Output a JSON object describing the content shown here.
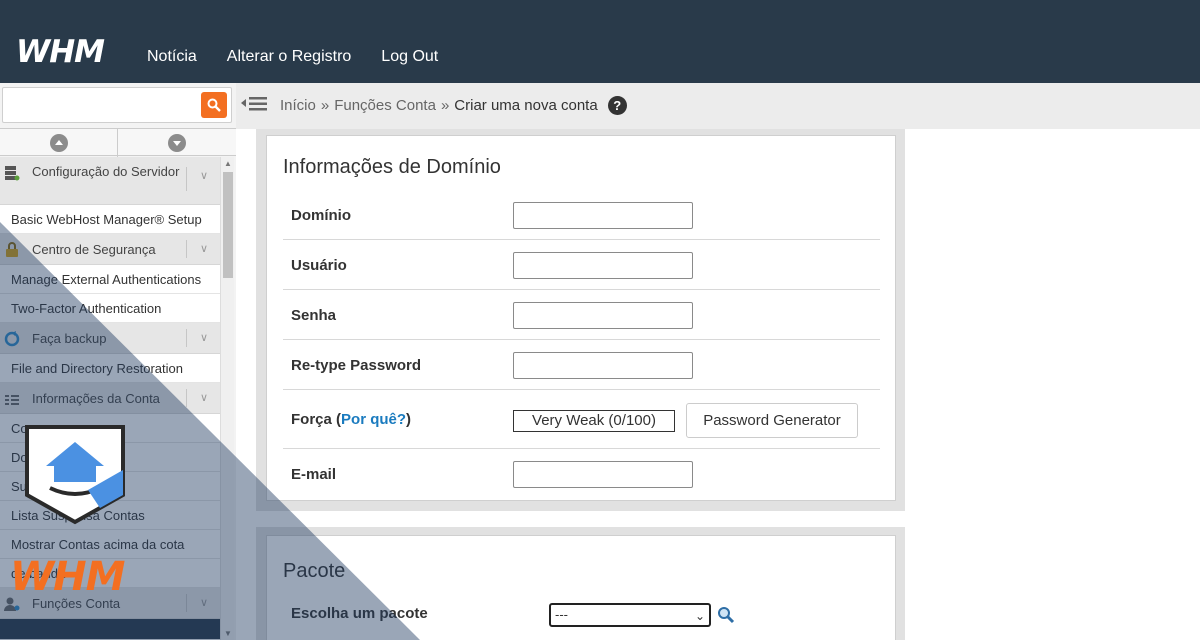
{
  "topbar": {
    "logo": "WHM",
    "nav": [
      "Notícia",
      "Alterar o Registro",
      "Log Out"
    ]
  },
  "sidebar": {
    "search": {
      "placeholder": ""
    },
    "sections": [
      {
        "icon": "server-config-icon",
        "label": "Configuração do Servidor",
        "items": [
          "Basic WebHost Manager® Setup"
        ]
      },
      {
        "icon": "lock-icon",
        "label": "Centro de Segurança",
        "items": [
          "Manage External Authentications",
          "Two-Factor Authentication"
        ]
      },
      {
        "icon": "backup-icon",
        "label": "Faça backup",
        "items": [
          "File and Directory Restoration"
        ]
      },
      {
        "icon": "account-info-icon",
        "label": "Informações da Conta",
        "items": [
          "Co",
          "Do                 ados lista",
          "Su",
          "Lista Suspensa Contas",
          "Mostrar Contas acima da cota",
          "               de banda"
        ]
      },
      {
        "icon": "account-functions-icon",
        "label": "Funções Conta",
        "items": []
      }
    ]
  },
  "breadcrumb": {
    "items": [
      "Início",
      "Funções Conta"
    ],
    "separator": "»",
    "current": "Criar uma nova conta",
    "help": "?"
  },
  "domain_panel": {
    "title": "Informações de Domínio",
    "fields": {
      "domain": "Domínio",
      "user": "Usuário",
      "password": "Senha",
      "retype": "Re-type Password",
      "strength_label": "Força",
      "strength_link": "Por quê?",
      "strength_value": "Very Weak (0/100)",
      "password_generator": "Password Generator",
      "email": "E-mail"
    }
  },
  "package_panel": {
    "title": "Pacote",
    "choose_label": "Escolha um pacote",
    "select_value": "---"
  },
  "watermark": {
    "logo_text": "WHM"
  },
  "colors": {
    "topbar": "#293a4a",
    "accent": "#f36f21",
    "link": "#1a7bbf",
    "watermark": "#2e5a9a"
  }
}
